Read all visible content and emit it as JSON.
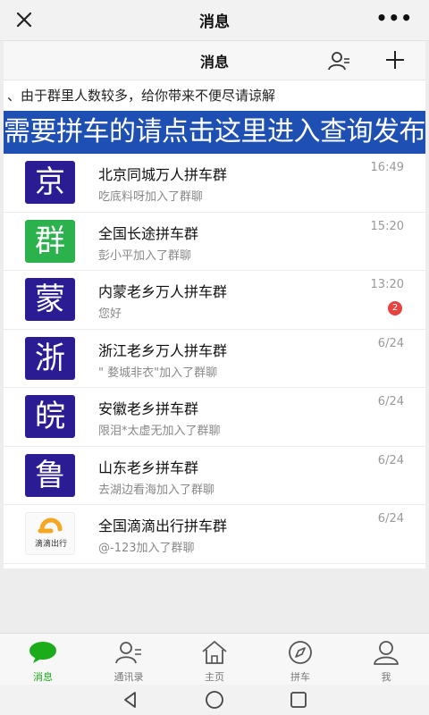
{
  "topbar": {
    "title": "消息",
    "more": "•••"
  },
  "subheader": {
    "title": "消息"
  },
  "notice": "、由于群里人数较多，给你带来不便尽请谅解",
  "banner": "需要拼车的请点击这里进入查询发布",
  "chats": [
    {
      "avatar_char": "京",
      "name": "北京同城万人拼车群",
      "message": "吃底料呀加入了群聊",
      "time": "16:49",
      "badge": ""
    },
    {
      "avatar_char": "群",
      "name": "全国长途拼车群",
      "message": "彭小平加入了群聊",
      "time": "15:20",
      "badge": ""
    },
    {
      "avatar_char": "蒙",
      "name": "内蒙老乡万人拼车群",
      "message": "您好",
      "time": "13:20",
      "badge": "2"
    },
    {
      "avatar_char": "浙",
      "name": "浙江老乡万人拼车群",
      "message": "\" 婺城非衣\"加入了群聊",
      "time": "6/24",
      "badge": ""
    },
    {
      "avatar_char": "皖",
      "name": "安徽老乡拼车群",
      "message": "限泪*太虚无加入了群聊",
      "time": "6/24",
      "badge": ""
    },
    {
      "avatar_char": "鲁",
      "name": "山东老乡拼车群",
      "message": "去湖边看海加入了群聊",
      "time": "6/24",
      "badge": ""
    },
    {
      "avatar_char": "滴滴出行",
      "name": "全国滴滴出行拼车群",
      "message": "@-123加入了群聊",
      "time": "6/24",
      "badge": ""
    }
  ],
  "tabs": [
    {
      "label": "消息",
      "icon": "chat-bubble-icon"
    },
    {
      "label": "通讯录",
      "icon": "contacts-icon"
    },
    {
      "label": "主页",
      "icon": "home-icon"
    },
    {
      "label": "拼车",
      "icon": "compass-icon"
    },
    {
      "label": "我",
      "icon": "person-icon"
    }
  ],
  "colors": {
    "accent": "#1aad19",
    "banner": "#1e4fb3",
    "avatar_purple": "#2c1c94",
    "avatar_green": "#2bb24c",
    "badge": "#e64340"
  }
}
